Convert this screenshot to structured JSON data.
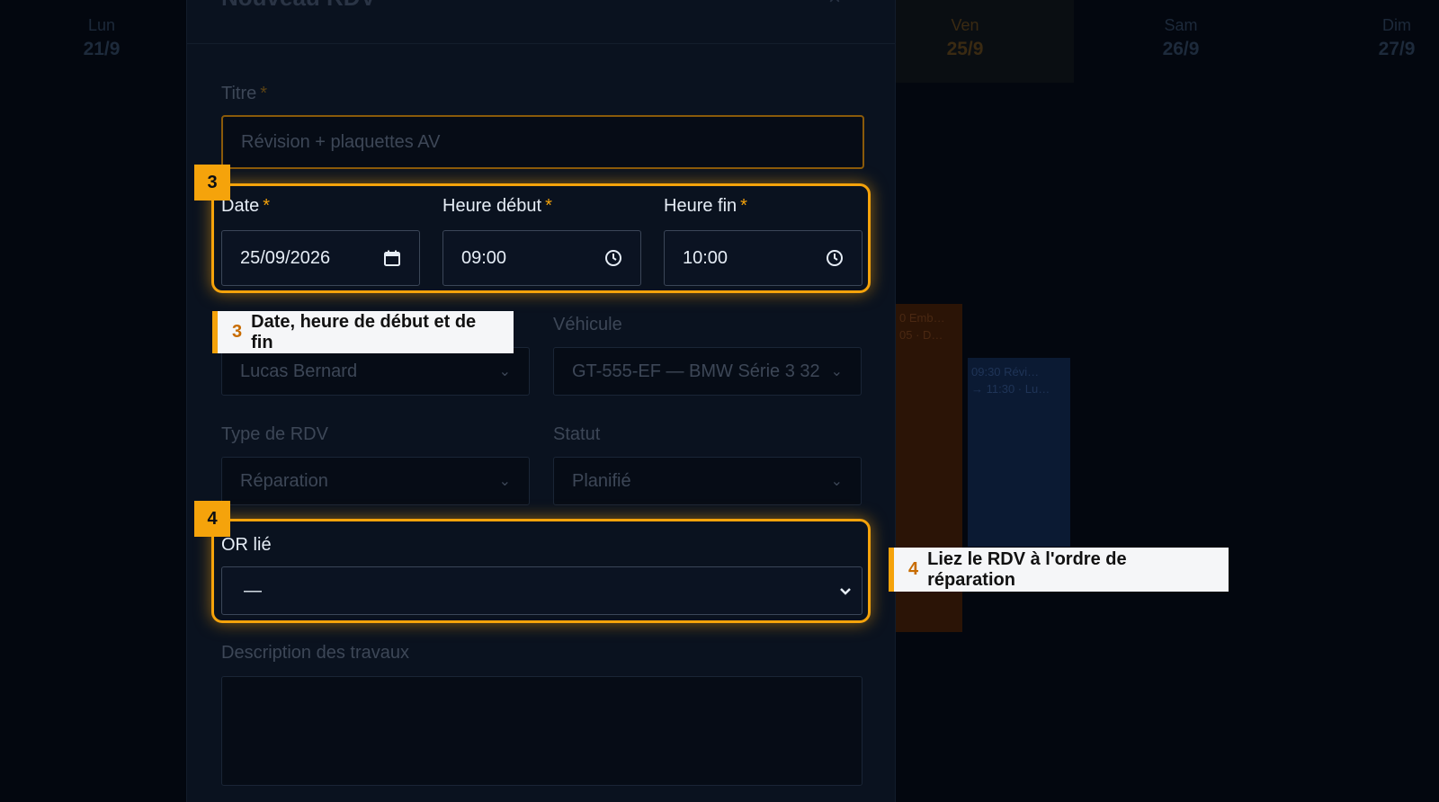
{
  "calendar": {
    "days": [
      {
        "name": "Lun",
        "date": "21/9"
      },
      {
        "name": "Ven",
        "date": "25/9"
      },
      {
        "name": "Sam",
        "date": "26/9"
      },
      {
        "name": "Dim",
        "date": "27/9"
      }
    ],
    "events": [
      {
        "line1": "0 Emb…",
        "line2": "05 · D…"
      },
      {
        "line1": "09:30 Révi…",
        "line2": "→ 11:30 · Lu…"
      }
    ]
  },
  "modal": {
    "title": "Nouveau RDV",
    "close_icon": "×",
    "required_marker": "*",
    "titre": {
      "label": "Titre",
      "value": "Révision + plaquettes AV"
    },
    "date": {
      "label": "Date",
      "value": "25/09/2026"
    },
    "heure_debut": {
      "label": "Heure début",
      "value": "09:00"
    },
    "heure_fin": {
      "label": "Heure fin",
      "value": "10:00"
    },
    "client": {
      "value": "Lucas Bernard"
    },
    "vehicule": {
      "label": "Véhicule",
      "value": "GT-555-EF — BMW Série 3 32"
    },
    "type_rdv": {
      "label": "Type de RDV",
      "value": "Réparation"
    },
    "statut": {
      "label": "Statut",
      "value": "Planifié"
    },
    "or_lie": {
      "label": "OR lié",
      "value": "—"
    },
    "description": {
      "label": "Description des travaux",
      "value": ""
    }
  },
  "annotations": {
    "step3": {
      "badge": "3",
      "text": "Date, heure de début et de fin"
    },
    "step4": {
      "badge": "4",
      "text": "Liez le RDV à l'ordre de réparation"
    }
  },
  "colors": {
    "accent": "#f5a30b",
    "modal_bg": "#0a121f",
    "page_bg": "#03070f"
  }
}
